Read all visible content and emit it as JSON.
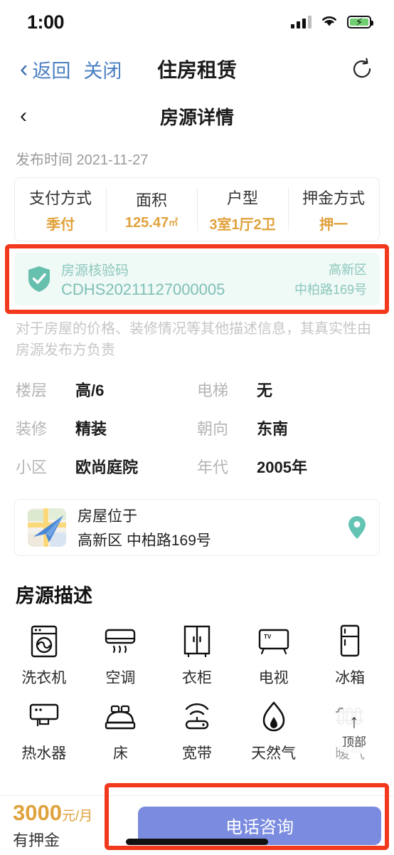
{
  "statusbar": {
    "time": "1:00",
    "signal_icon": "signal-bars-icon",
    "wifi_icon": "wifi-icon",
    "battery_icon": "battery-charging-icon"
  },
  "navbar": {
    "back_label": "返回",
    "close_label": "关闭",
    "title": "住房租赁",
    "refresh_icon": "refresh-icon",
    "back_chevron_icon": "chevron-left-icon"
  },
  "subheader": {
    "back_icon": "chevron-left-icon",
    "title": "房源详情"
  },
  "publish": {
    "text": "发布时间 2021-11-27"
  },
  "spec_card": {
    "items": [
      {
        "label": "支付方式",
        "value": "季付",
        "unit": ""
      },
      {
        "label": "面积",
        "value": "125.47",
        "unit": "㎡"
      },
      {
        "label": "户型",
        "value": "3室1厅2卫",
        "unit": ""
      },
      {
        "label": "押金方式",
        "value": "押一",
        "unit": ""
      }
    ]
  },
  "verify": {
    "shield_icon": "shield-check-icon",
    "title": "房源核验码",
    "code": "CDHS20211127000005",
    "district": "高新区",
    "address": "中柏路169号",
    "bg_color": "#eff9f6",
    "text_color": "#7fc0b6",
    "highlight_color": "#f2391d"
  },
  "disclaimer": {
    "text": "对于房屋的价格、装修情况等其他描述信息，其真实性由房源发布方负责"
  },
  "details": [
    {
      "label": "楼层",
      "value": "高/6"
    },
    {
      "label": "电梯",
      "value": "无"
    },
    {
      "label": "装修",
      "value": "精装"
    },
    {
      "label": "朝向",
      "value": "东南"
    },
    {
      "label": "小区",
      "value": "欧尚庭院"
    },
    {
      "label": "年代",
      "value": "2005年"
    }
  ],
  "location": {
    "map_icon": "map-thumbnail-icon",
    "plane_icon": "paper-plane-icon",
    "line1": "房屋位于",
    "line2": "高新区 中柏路169号",
    "pin_icon": "map-pin-icon",
    "pin_color": "#63c4b4"
  },
  "description_section": {
    "title": "房源描述"
  },
  "amenities": [
    {
      "name": "洗衣机",
      "icon": "washing-machine-icon",
      "faded": false
    },
    {
      "name": "空调",
      "icon": "air-conditioner-icon",
      "faded": false
    },
    {
      "name": "衣柜",
      "icon": "wardrobe-icon",
      "faded": false
    },
    {
      "name": "电视",
      "icon": "tv-icon",
      "faded": false
    },
    {
      "name": "冰箱",
      "icon": "refrigerator-icon",
      "faded": false
    },
    {
      "name": "热水器",
      "icon": "water-heater-icon",
      "faded": false
    },
    {
      "name": "床",
      "icon": "bed-icon",
      "faded": false
    },
    {
      "name": "宽带",
      "icon": "broadband-router-icon",
      "faded": false
    },
    {
      "name": "天然气",
      "icon": "natural-gas-flame-icon",
      "faded": false
    },
    {
      "name": "暖气",
      "icon": "radiator-heating-icon",
      "faded": true
    }
  ],
  "to_top": {
    "arrow_icon": "arrow-up-icon",
    "label": "顶部"
  },
  "bottombar": {
    "price_number": "3000",
    "price_unit": "元/月",
    "price_sub": "有押金",
    "call_label": "电话咨询",
    "call_color": "#7b8ce0",
    "price_color": "#e0a23c"
  }
}
